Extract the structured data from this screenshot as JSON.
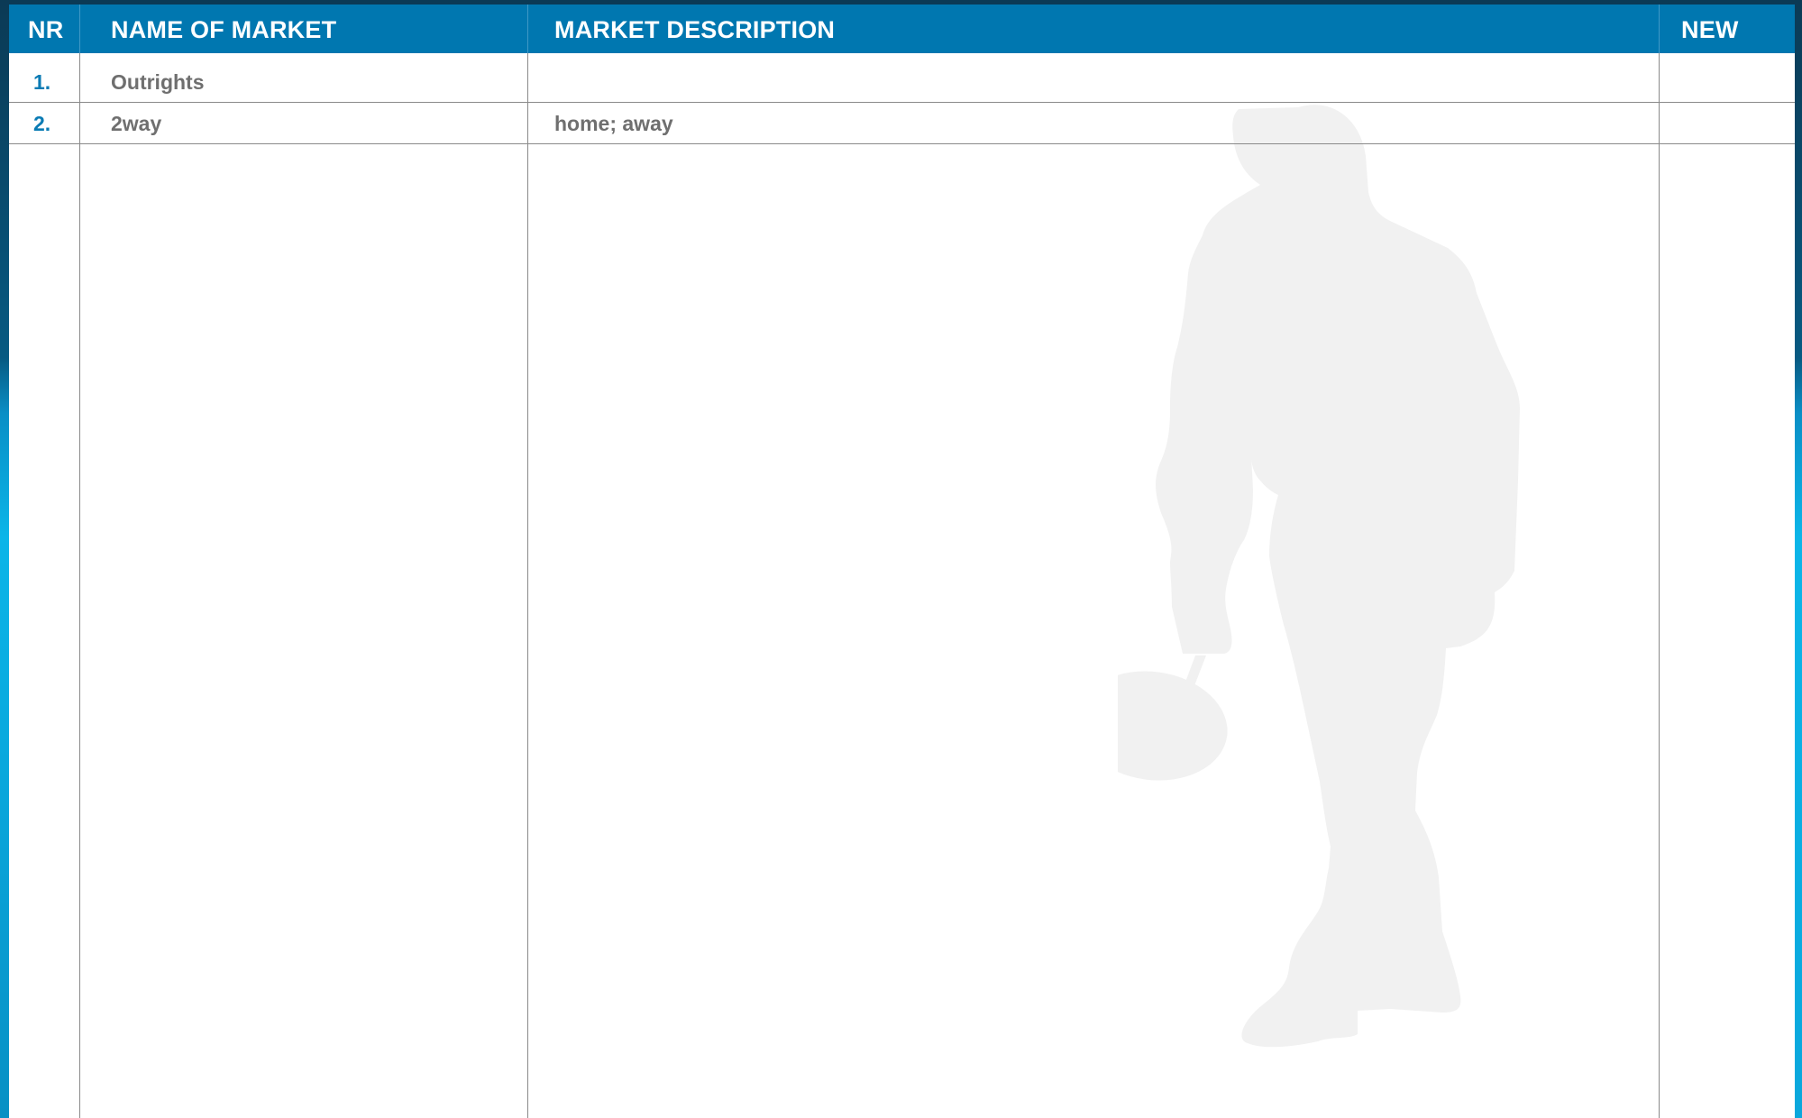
{
  "table": {
    "headers": {
      "nr": "NR",
      "name": "NAME OF MARKET",
      "description": "MARKET DESCRIPTION",
      "new": "NEW"
    },
    "rows": [
      {
        "nr": "1.",
        "name": "Outrights",
        "description": "",
        "new": ""
      },
      {
        "nr": "2.",
        "name": "2way",
        "description": "home; away",
        "new": ""
      }
    ]
  },
  "colors": {
    "header_background": "#0077b0",
    "header_text": "#ffffff",
    "number_text": "#0a7bb4",
    "body_text": "#6f6f6f",
    "grid_lines": "#8a8a8a",
    "silhouette": "#f1f1f1"
  },
  "watermark": {
    "icon": "badminton-player-silhouette"
  }
}
